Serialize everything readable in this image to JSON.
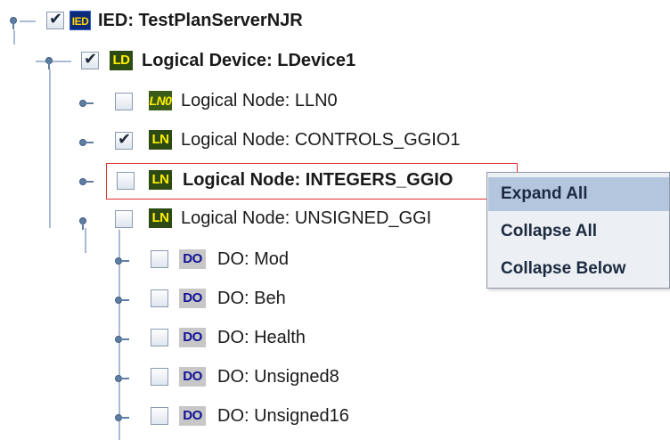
{
  "tree": {
    "ied": {
      "badge": "IED",
      "label": "IED: TestPlanServerNJR",
      "checked": true
    },
    "ldevice": {
      "badge": "LD",
      "label": "Logical Device: LDevice1",
      "checked": true
    },
    "nodes": [
      {
        "badge": "LN0",
        "label": "Logical Node: LLN0",
        "checked": false
      },
      {
        "badge": "LN",
        "label": "Logical Node: CONTROLS_GGIO1",
        "checked": true
      },
      {
        "badge": "LN",
        "label": "Logical Node: INTEGERS_GGIO",
        "checked": false,
        "selected": true
      },
      {
        "badge": "LN",
        "label": "Logical Node: UNSIGNED_GGI",
        "checked": false
      }
    ],
    "data_objects": [
      {
        "badge": "DO",
        "label": "DO: Mod",
        "checked": false
      },
      {
        "badge": "DO",
        "label": "DO: Beh",
        "checked": false
      },
      {
        "badge": "DO",
        "label": "DO: Health",
        "checked": false
      },
      {
        "badge": "DO",
        "label": "DO: Unsigned8",
        "checked": false
      },
      {
        "badge": "DO",
        "label": "DO: Unsigned16",
        "checked": false
      }
    ],
    "check_glyph": "✔"
  },
  "context_menu": {
    "items": [
      {
        "label": "Expand All",
        "highlighted": true
      },
      {
        "label": "Collapse All",
        "highlighted": false
      },
      {
        "label": "Collapse Below",
        "highlighted": false
      }
    ]
  },
  "colors": {
    "connector": "#a9bcd3",
    "selection_border": "#e03030",
    "menu_highlight": "#b4c6de"
  }
}
